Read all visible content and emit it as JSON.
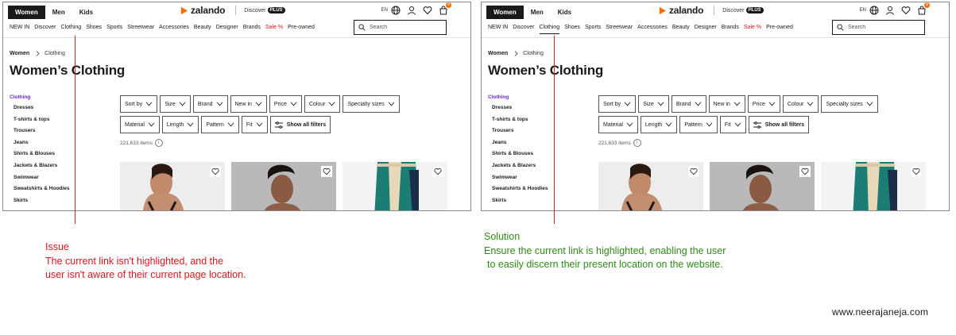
{
  "mockups": [
    {
      "variant": "issue",
      "gender_tabs": [
        "Women",
        "Men",
        "Kids"
      ],
      "active_gender": "Women",
      "logo_text": "zalando",
      "discover_label": "Discover",
      "plus_label": "PLUS",
      "language": "EN",
      "bag_count": "0",
      "nav": [
        {
          "label": "NEW IN"
        },
        {
          "label": "Discover"
        },
        {
          "label": "Clothing",
          "current": true
        },
        {
          "label": "Shoes"
        },
        {
          "label": "Sports"
        },
        {
          "label": "Streetwear"
        },
        {
          "label": "Accessories"
        },
        {
          "label": "Beauty"
        },
        {
          "label": "Designer"
        },
        {
          "label": "Brands"
        },
        {
          "label": "Sale %",
          "sale": true
        },
        {
          "label": "Pre-owned"
        }
      ],
      "current_link_highlighted": false,
      "search_placeholder": "Search",
      "breadcrumb": [
        "Women",
        "Clothing"
      ],
      "page_title": "Women’s Clothing",
      "sidebar_heading": "Clothing",
      "sidebar_items": [
        "Dresses",
        "T-shirts & tops",
        "Trousers",
        "Jeans",
        "Shirts & Blouses",
        "Jackets & Blazers",
        "Swimwear",
        "Sweatshirts & Hoodies",
        "Skirts"
      ],
      "filters_row1": [
        "Sort by",
        "Size",
        "Brand",
        "New in",
        "Price",
        "Colour",
        "Specialty sizes"
      ],
      "filters_row2": [
        "Material",
        "Length",
        "Pattern",
        "Fit"
      ],
      "show_all_filters": "Show all filters",
      "items_count": "221,633 items"
    },
    {
      "variant": "solution",
      "gender_tabs": [
        "Women",
        "Men",
        "Kids"
      ],
      "active_gender": "Women",
      "logo_text": "zalando",
      "discover_label": "Discover",
      "plus_label": "PLUS",
      "language": "EN",
      "bag_count": "0",
      "nav": [
        {
          "label": "NEW IN"
        },
        {
          "label": "Discover"
        },
        {
          "label": "Clothing",
          "current": true
        },
        {
          "label": "Shoes"
        },
        {
          "label": "Sports"
        },
        {
          "label": "Streetwear"
        },
        {
          "label": "Accessories"
        },
        {
          "label": "Beauty"
        },
        {
          "label": "Designer"
        },
        {
          "label": "Brands"
        },
        {
          "label": "Sale %",
          "sale": true
        },
        {
          "label": "Pre-owned"
        }
      ],
      "current_link_highlighted": true,
      "search_placeholder": "Search",
      "breadcrumb": [
        "Women",
        "Clothing"
      ],
      "page_title": "Women’s Clothing",
      "sidebar_heading": "Clothing",
      "sidebar_items": [
        "Dresses",
        "T-shirts & tops",
        "Trousers",
        "Jeans",
        "Shirts & Blouses",
        "Jackets & Blazers",
        "Swimwear",
        "Sweatshirts & Hoodies",
        "Skirts"
      ],
      "filters_row1": [
        "Sort by",
        "Size",
        "Brand",
        "New in",
        "Price",
        "Colour",
        "Specialty sizes"
      ],
      "filters_row2": [
        "Material",
        "Length",
        "Pattern",
        "Fit"
      ],
      "show_all_filters": "Show all filters",
      "items_count": "221,633 items"
    }
  ],
  "annotations": {
    "issue": {
      "lines": [
        "Issue",
        "The current link isn't highlighted, and the",
        "user isn't aware of their current page location."
      ],
      "color": "#e0141e"
    },
    "solution": {
      "lines": [
        "Solution",
        "Ensure the current link is highlighted, enabling the user",
        " to easily discern their present location on the website."
      ],
      "color": "#2e8b17"
    }
  },
  "credit": "www.neerajaneja.com",
  "colors": {
    "brand_orange": "#ff6900",
    "sidebar_active": "#6328e0",
    "sale_red": "#e8131d",
    "marker_red": "#d02020"
  },
  "icons": [
    "zalando-logo-icon",
    "globe-icon",
    "user-icon",
    "heart-icon",
    "bag-icon",
    "search-icon",
    "chevron-down-icon",
    "sliders-icon",
    "info-icon"
  ]
}
